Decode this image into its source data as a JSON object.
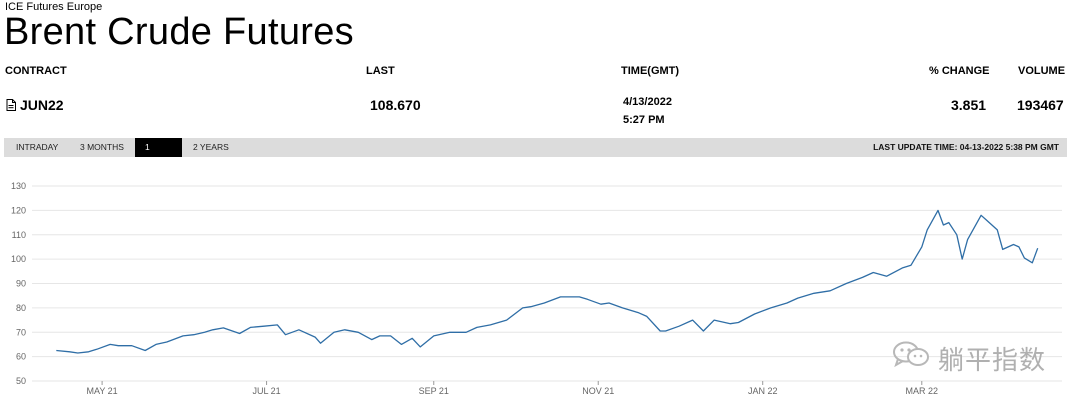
{
  "exchange": "ICE Futures Europe",
  "title": "Brent Crude Futures",
  "table": {
    "headers": {
      "contract": "CONTRACT",
      "last": "LAST",
      "time": "TIME(GMT)",
      "change": "% CHANGE",
      "volume": "VOLUME"
    },
    "row": {
      "contract": "JUN22",
      "contract_icon": "document-icon",
      "last": "108.670",
      "date": "4/13/2022",
      "time": "5:27 PM",
      "change": "3.851",
      "volume": "193467"
    }
  },
  "tabs": [
    {
      "label": "INTRADAY",
      "active": false
    },
    {
      "label": "3 MONTHS",
      "active": false
    },
    {
      "label": "1 YEAR",
      "active": true
    },
    {
      "label": "2 YEARS",
      "active": false
    }
  ],
  "last_update": "LAST UPDATE TIME: 04-13-2022 5:38 PM GMT",
  "watermark": {
    "text": "躺平指数",
    "icon": "wechat-icon"
  },
  "colors": {
    "line": "#2f6ea6",
    "toolbar": "#dcdcdc",
    "active_tab": "#000000"
  },
  "chart_data": {
    "type": "line",
    "title": "",
    "xlabel": "",
    "ylabel": "",
    "ylim": [
      50,
      130
    ],
    "yticks": [
      50,
      60,
      70,
      80,
      90,
      100,
      110,
      120,
      130
    ],
    "xticks": [
      {
        "label": "MAY 21",
        "date": "2021-05-01"
      },
      {
        "label": "JUL 21",
        "date": "2021-07-01"
      },
      {
        "label": "SEP 21",
        "date": "2021-09-01"
      },
      {
        "label": "NOV 21",
        "date": "2021-11-01"
      },
      {
        "label": "JAN 22",
        "date": "2022-01-01"
      },
      {
        "label": "MAR 22",
        "date": "2022-03-01"
      }
    ],
    "grid": true,
    "series": [
      {
        "x": [
          "2021-04-14",
          "2021-04-19",
          "2021-04-22",
          "2021-04-26",
          "2021-04-29",
          "2021-05-04",
          "2021-05-07",
          "2021-05-12",
          "2021-05-17",
          "2021-05-21",
          "2021-05-25",
          "2021-05-31",
          "2021-06-04",
          "2021-06-08",
          "2021-06-11",
          "2021-06-15",
          "2021-06-21",
          "2021-06-25",
          "2021-06-30",
          "2021-07-05",
          "2021-07-08",
          "2021-07-13",
          "2021-07-19",
          "2021-07-21",
          "2021-07-26",
          "2021-07-30",
          "2021-08-04",
          "2021-08-09",
          "2021-08-12",
          "2021-08-16",
          "2021-08-20",
          "2021-08-24",
          "2021-08-27",
          "2021-09-01",
          "2021-09-07",
          "2021-09-13",
          "2021-09-17",
          "2021-09-22",
          "2021-09-28",
          "2021-10-04",
          "2021-10-07",
          "2021-10-12",
          "2021-10-18",
          "2021-10-25",
          "2021-10-28",
          "2021-11-02",
          "2021-11-05",
          "2021-11-10",
          "2021-11-16",
          "2021-11-19",
          "2021-11-24",
          "2021-11-26",
          "2021-12-01",
          "2021-12-06",
          "2021-12-10",
          "2021-12-14",
          "2021-12-20",
          "2021-12-23",
          "2021-12-29",
          "2022-01-04",
          "2022-01-10",
          "2022-01-14",
          "2022-01-20",
          "2022-01-26",
          "2022-02-01",
          "2022-02-07",
          "2022-02-11",
          "2022-02-16",
          "2022-02-22",
          "2022-02-25",
          "2022-03-01",
          "2022-03-03",
          "2022-03-07",
          "2022-03-09",
          "2022-03-11",
          "2022-03-14",
          "2022-03-16",
          "2022-03-18",
          "2022-03-23",
          "2022-03-25",
          "2022-03-29",
          "2022-03-31",
          "2022-04-04",
          "2022-04-06",
          "2022-04-08",
          "2022-04-11",
          "2022-04-13"
        ],
        "values": [
          62.5,
          62,
          61.5,
          62,
          63,
          65,
          64.5,
          64.5,
          62.5,
          65,
          66,
          68.5,
          69,
          70,
          71,
          71.8,
          69.5,
          72,
          72.5,
          73,
          69,
          71,
          68,
          65.5,
          70,
          71,
          70,
          67,
          68.5,
          68.5,
          65,
          67.5,
          64,
          68.5,
          70,
          70,
          72,
          73,
          75,
          80,
          80.5,
          82,
          84.5,
          84.5,
          83.5,
          81.5,
          82,
          80,
          78,
          76.5,
          70.5,
          70.5,
          72.5,
          75,
          70.5,
          75,
          73.5,
          74,
          77.5,
          80,
          82,
          84,
          86,
          87,
          90,
          92.5,
          94.5,
          93,
          96.5,
          97.5,
          105,
          112,
          120,
          114,
          115,
          110,
          100,
          108,
          118,
          116,
          112,
          104,
          106,
          105,
          100.5,
          98.5,
          104.5
        ]
      }
    ]
  }
}
